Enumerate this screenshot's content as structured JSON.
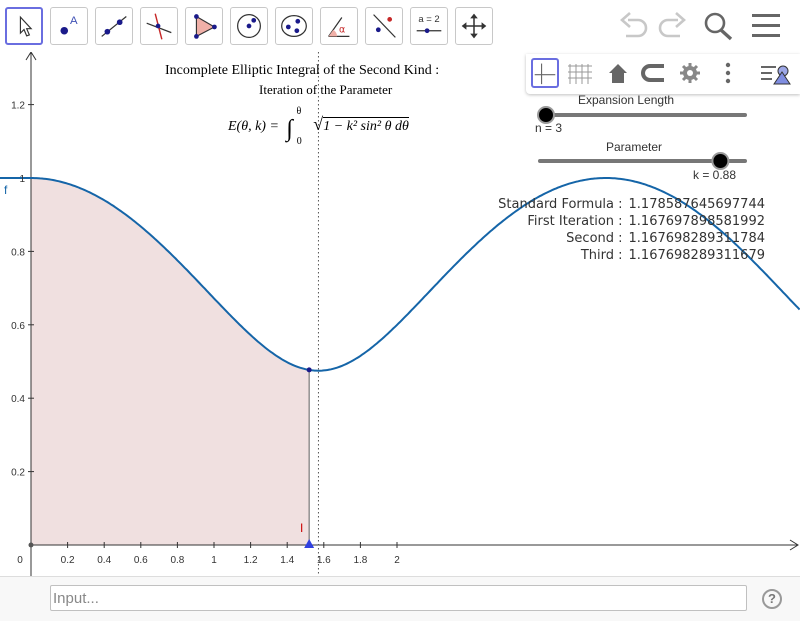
{
  "toolbar": {
    "tools": [
      {
        "name": "move-tool",
        "selected": true
      },
      {
        "name": "point-tool",
        "label": "A"
      },
      {
        "name": "line-tool"
      },
      {
        "name": "perpendicular-tool"
      },
      {
        "name": "polygon-tool"
      },
      {
        "name": "circle-tool"
      },
      {
        "name": "ellipse-tool"
      },
      {
        "name": "angle-tool",
        "label": "α"
      },
      {
        "name": "reflect-tool"
      },
      {
        "name": "slider-tool",
        "label": "a = 2"
      },
      {
        "name": "move-graphics-tool"
      }
    ],
    "right": [
      "undo-icon",
      "redo-icon",
      "search-icon",
      "menu-icon"
    ]
  },
  "stylebar": [
    "axes-icon",
    "grid-icon",
    "home-icon",
    "point-capturing-icon",
    "settings-icon",
    "more-icon",
    "algebra-toggle-icon"
  ],
  "graph": {
    "title": "Incomplete Elliptic Integral of the Second Kind :",
    "subtitle": "Iteration of the Parameter",
    "formula_lhs": "E(θ, k) =",
    "integral_upper": "θ",
    "integral_lower": "0",
    "formula_rhs": "1 − k² sin² θ  dθ",
    "function_label": "f",
    "integral_label": "I",
    "x_ticks": [
      "0",
      "0.2",
      "0.4",
      "0.6",
      "0.8",
      "1",
      "1.2",
      "1.4",
      "1.6",
      "1.8",
      "2"
    ],
    "y_ticks": [
      "0.2",
      "0.4",
      "0.6",
      "0.8",
      "1",
      "1.2"
    ],
    "slider_n": {
      "caption": "Expansion Length",
      "label": "n = 3",
      "value": 3
    },
    "slider_k": {
      "caption": "Parameter",
      "label": "k = 0.88",
      "value": 0.88
    },
    "results": [
      {
        "label": "Standard Formula :",
        "value": "1.178587645697744"
      },
      {
        "label": "First Iteration :",
        "value": "1.167697898581992"
      },
      {
        "label": "Second :",
        "value": "1.167698289311784"
      },
      {
        "label": "Third :",
        "value": "1.167698289311679"
      }
    ],
    "colors": {
      "curve": "#1565a8",
      "shade": "#f0e0e0",
      "integral_label": "#cc0000",
      "point": "#1a1a8a",
      "triangle": "#3040e0"
    }
  },
  "chart_data": {
    "type": "area",
    "function": "sqrt(1 - k^2 sin^2(x))",
    "k": 0.88,
    "theta": 1.52,
    "xlim": [
      0,
      2
    ],
    "ylim": [
      0,
      1.2
    ],
    "x": [
      0,
      0.2,
      0.4,
      0.6,
      0.8,
      1.0,
      1.2,
      1.4,
      1.52,
      1.6,
      1.8,
      2.0
    ],
    "y": [
      1.0,
      0.984,
      0.94,
      0.87,
      0.78,
      0.68,
      0.58,
      0.5,
      0.482,
      0.475,
      0.52,
      0.6
    ]
  },
  "inputbar": {
    "placeholder": "Input...",
    "help_label": "?"
  }
}
